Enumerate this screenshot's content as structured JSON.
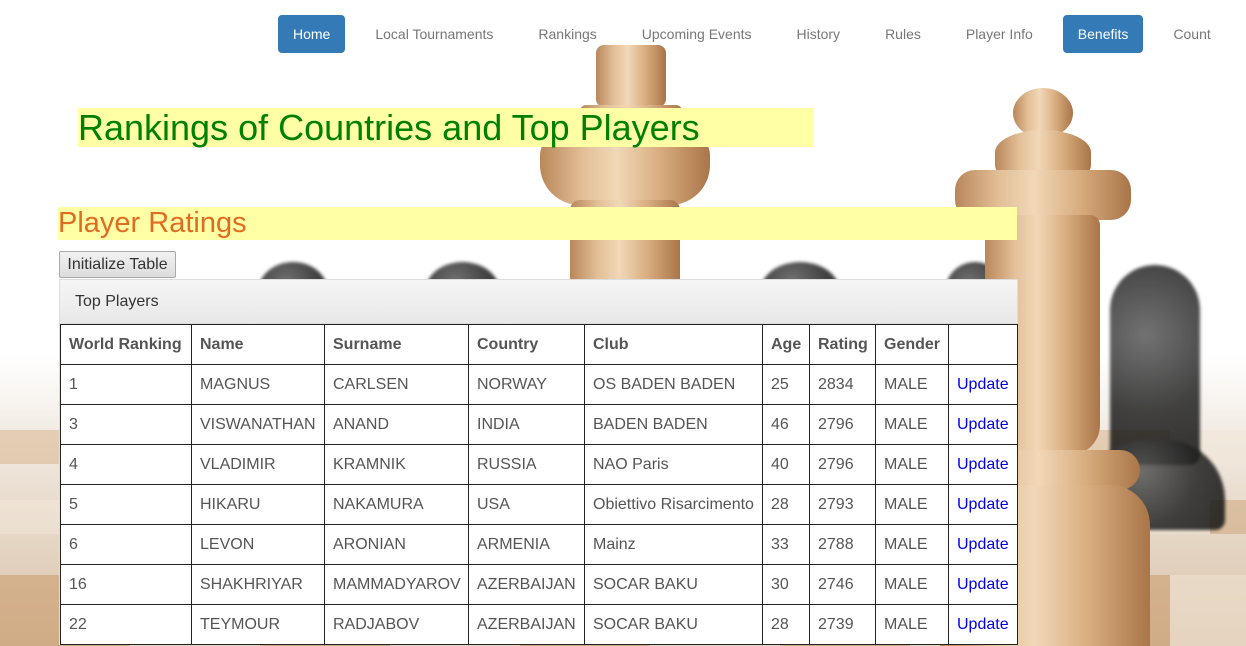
{
  "nav": {
    "items": [
      {
        "label": "Home",
        "active": true
      },
      {
        "label": "Local Tournaments",
        "active": false
      },
      {
        "label": "Rankings",
        "active": false
      },
      {
        "label": "Upcoming Events",
        "active": false
      },
      {
        "label": "History",
        "active": false
      },
      {
        "label": "Rules",
        "active": false
      },
      {
        "label": "Player Info",
        "active": false
      },
      {
        "label": "Benefits",
        "active": true
      },
      {
        "label": "Count",
        "active": false
      }
    ]
  },
  "page_title": "Rankings of Countries and Top Players",
  "section_title": "Player Ratings",
  "init_button_label": "Initialize Table",
  "panel": {
    "heading": "Top Players",
    "columns": [
      "World Ranking",
      "Name",
      "Surname",
      "Country",
      "Club",
      "Age",
      "Rating",
      "Gender",
      ""
    ],
    "rows": [
      {
        "ranking": "1",
        "name": "MAGNUS",
        "surname": "CARLSEN",
        "country": "NORWAY",
        "club": "OS BADEN BADEN",
        "age": "25",
        "rating": "2834",
        "gender": "MALE",
        "action": "Update"
      },
      {
        "ranking": "3",
        "name": "VISWANATHAN",
        "surname": "ANAND",
        "country": "INDIA",
        "club": "BADEN BADEN",
        "age": "46",
        "rating": "2796",
        "gender": "MALE",
        "action": "Update"
      },
      {
        "ranking": "4",
        "name": "VLADIMIR",
        "surname": "KRAMNIK",
        "country": "RUSSIA",
        "club": "NAO Paris",
        "age": "40",
        "rating": "2796",
        "gender": "MALE",
        "action": "Update"
      },
      {
        "ranking": "5",
        "name": "HIKARU",
        "surname": "NAKAMURA",
        "country": "USA",
        "club": "Obiettivo Risarcimento",
        "age": "28",
        "rating": "2793",
        "gender": "MALE",
        "action": "Update"
      },
      {
        "ranking": "6",
        "name": "LEVON",
        "surname": "ARONIAN",
        "country": "ARMENIA",
        "club": "Mainz",
        "age": "33",
        "rating": "2788",
        "gender": "MALE",
        "action": "Update"
      },
      {
        "ranking": "16",
        "name": "SHAKHRIYAR",
        "surname": "MAMMADYAROV",
        "country": "AZERBAIJAN",
        "club": "SOCAR BAKU",
        "age": "30",
        "rating": "2746",
        "gender": "MALE",
        "action": "Update"
      },
      {
        "ranking": "22",
        "name": "TEYMOUR",
        "surname": "RADJABOV",
        "country": "AZERBAIJAN",
        "club": "SOCAR BAKU",
        "age": "28",
        "rating": "2739",
        "gender": "MALE",
        "action": "Update"
      }
    ]
  },
  "colors": {
    "nav_active_bg": "#337ab7",
    "title_green": "#008000",
    "section_orange": "#e06b22",
    "highlight_yellow": "#ffffa6",
    "link_blue": "#0000ee"
  }
}
